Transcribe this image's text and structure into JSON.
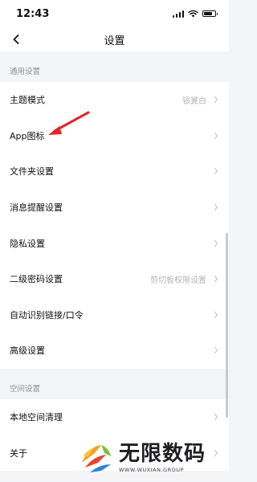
{
  "status_bar": {
    "time": "12:43"
  },
  "nav": {
    "title": "设置"
  },
  "sections": [
    {
      "header": "通用设置",
      "items": [
        {
          "label": "主题模式",
          "value": "银翼白"
        },
        {
          "label": "App图标",
          "value": ""
        },
        {
          "label": "文件夹设置",
          "value": ""
        },
        {
          "label": "消息提醒设置",
          "value": ""
        },
        {
          "label": "隐私设置",
          "value": ""
        },
        {
          "label": "二级密码设置",
          "value": "剪切板权限设置"
        },
        {
          "label": "自动识别链接/口令",
          "value": ""
        },
        {
          "label": "高级设置",
          "value": ""
        }
      ]
    },
    {
      "header": "空间设置",
      "items": [
        {
          "label": "本地空间清理",
          "value": ""
        },
        {
          "label": "关于",
          "value": ""
        }
      ]
    }
  ],
  "watermark": {
    "title": "无限数码",
    "subtitle": "WWW.WUXIAN.GROUP"
  },
  "colors": {
    "annotation_arrow": "#e0262b",
    "chevron": "#c7c7cc",
    "background": "#f4f5f7"
  }
}
